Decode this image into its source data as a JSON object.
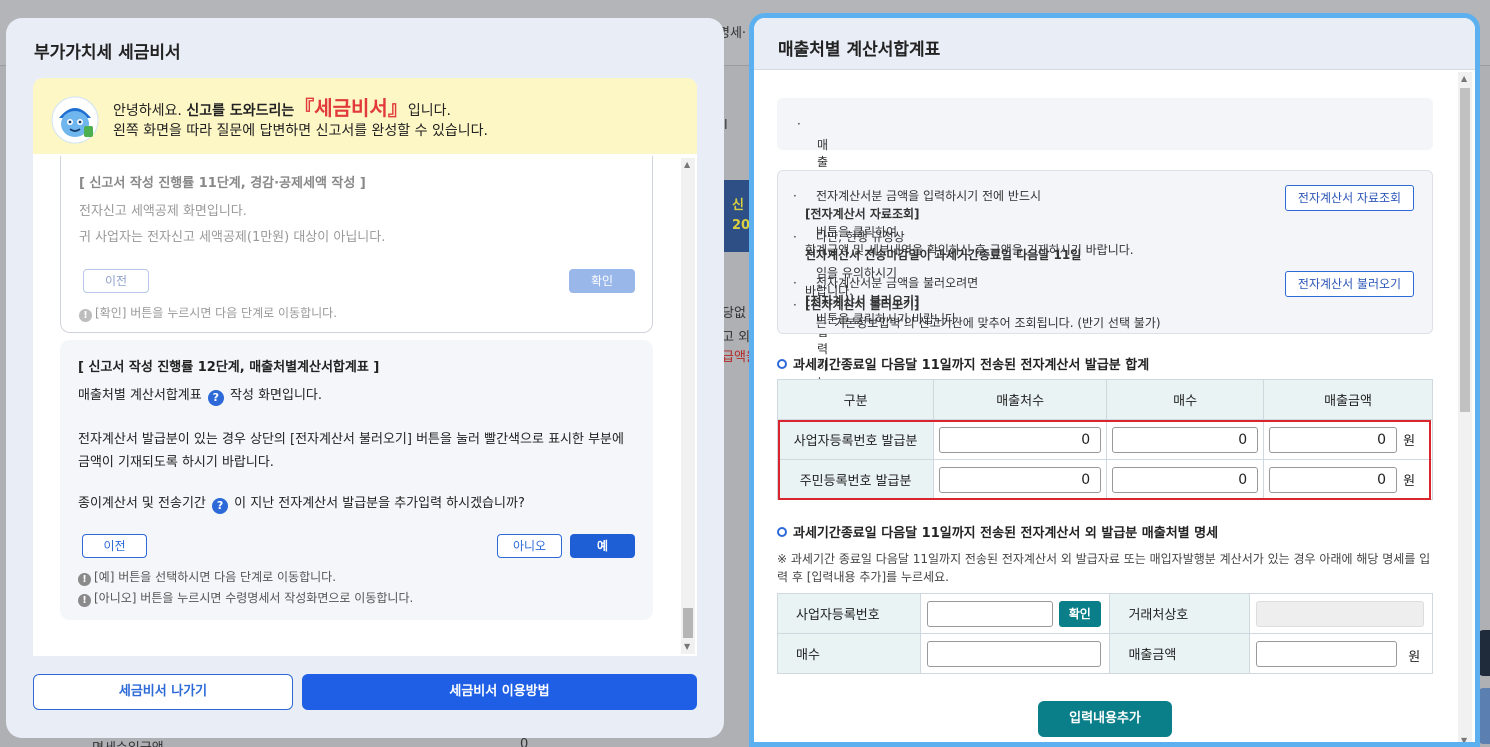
{
  "background": {
    "frag_top": "명세·",
    "frag_line1": "당없",
    "frag_line2": "고 외",
    "frag_line3": "급액을",
    "frag_card_top": "신",
    "frag_card_bottom": "20",
    "frag_bottom": "면세수입금액",
    "frag_pipe": "l",
    "frag_bottom_val": "0"
  },
  "left_modal": {
    "title": "부가가치세 세금비서",
    "greeting_prefix": "안녕하세요.",
    "greeting_bold": "신고를 도와드리는",
    "brand": "『세금비서』",
    "greeting_suffix": "입니다.",
    "greeting_line2": "왼쪽 화면을 따라 질문에 답변하면 신고서를 완성할 수 있습니다.",
    "step11": {
      "title": "[ 신고서 작성 진행률 11단계, 경감·공제세액 작성 ]",
      "line1": "전자신고 세액공제 화면입니다.",
      "line2": "귀 사업자는 전자신고 세액공제(1만원) 대상이 아닙니다.",
      "prev_label": "이전",
      "ok_label": "확인",
      "note": "[확인] 버튼을 누르시면 다음 단계로 이동합니다."
    },
    "step12": {
      "title": "[ 신고서 작성 진행률 12단계, 매출처별계산서합계표 ]",
      "line1_a": "매출처별 계산서합계표",
      "line1_b": "작성 화면입니다.",
      "line2": "전자계산서 발급분이 있는 경우 상단의 [전자계산서 불러오기] 버튼을 눌러 빨간색으로 표시한 부분에",
      "line3": "금액이 기재되도록 하시기 바랍니다.",
      "line4_a": "종이계산서 및 전송기간",
      "line4_b": "이 지난 전자계산서 발급분을 추가입력 하시겠습니까?",
      "prev_label": "이전",
      "no_label": "아니오",
      "yes_label": "예",
      "note1": "[예] 버튼을 선택하시면 다음 단계로 이동합니다.",
      "note2": "[아니오] 버튼을 누르시면 수령명세서 작성화면으로 이동합니다."
    },
    "footer": {
      "exit_label": "세금비서 나가기",
      "guide_label": "세금비서 이용방법"
    }
  },
  "right_modal": {
    "title": "매출처별 계산서합계표",
    "intro": "매출처별 계산서합계표를 입력하는 화면입니다.",
    "notice": {
      "b1_pre": "전자계산서분 금액을 입력하시기 전에 반드시 ",
      "b1_bold": "[전자계산서 자료조회]",
      "b1_post": " 버튼을 클릭하여",
      "b1_line2": "합계금액 및 세부내역을 확인하신 후 금액을 기재하시기 바랍니다.",
      "b2_pre": "다만, 현행 규정상 ",
      "b2_bold": "전자계산서 전송마감일이 과세기간종료일 다음달 11일",
      "b2_post": "임을 유의하시기",
      "b2_line2": "바랍니다.",
      "b3_pre": "전자계산서분 금액을 불러오려면 ",
      "b3_bold": "[전자계산서 불러오기]",
      "b3_post": " 버튼을 클릭하시기 바랍니다.",
      "b4_bold": "[전자계산서 불러오기]",
      "b4_post": "는 '기본정보입력'의 신고기간에 맞추어 조회됩니다. (반기 선택 불가)",
      "lookup_btn": "전자계산서 자료조회",
      "load_btn": "전자계산서 불러오기"
    },
    "section1": {
      "title": "과세기간종료일 다음달 11일까지 전송된 전자계산서 발급분 합계",
      "headers": [
        "구분",
        "매출처수",
        "매수",
        "매출금액"
      ],
      "rows": [
        {
          "label": "사업자등록번호 발급분",
          "count": "0",
          "sheets": "0",
          "amount": "0"
        },
        {
          "label": "주민등록번호 발급분",
          "count": "0",
          "sheets": "0",
          "amount": "0"
        }
      ],
      "unit": "원"
    },
    "section2": {
      "title": "과세기간종료일 다음달 11일까지 전송된 전자계산서 외 발급분 매출처별 명세",
      "note": "※ 과세기간 종료일 다음달 11일까지 전송된 전자계산서 외 발급자료 또는 매입자발행분 계산서가 있는 경우 아래에 해당 명세를 입력 후 [입력내용 추가]를 누르세요.",
      "biz_no_label": "사업자등록번호",
      "confirm_btn": "확인",
      "partner_label": "거래처상호",
      "sheets_label": "매수",
      "amount_label": "매출금액",
      "unit": "원",
      "add_btn": "입력내용추가"
    }
  },
  "colors": {
    "primary": "#1f5fe6",
    "teal": "#0a7f8a",
    "highlight_red": "#d8252e",
    "brand_red": "#e23a3a",
    "modal_border": "#5db0ef"
  }
}
